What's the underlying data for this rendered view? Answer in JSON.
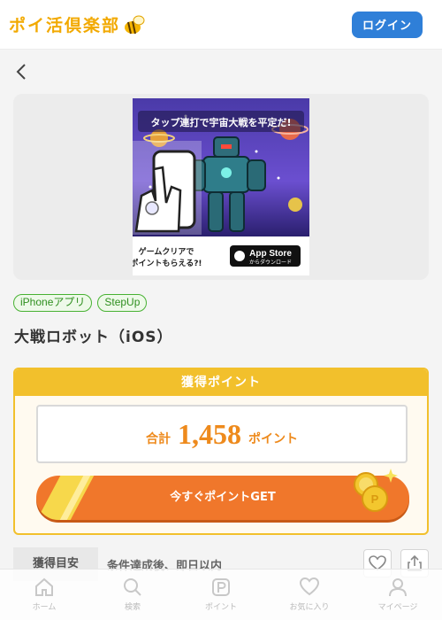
{
  "header": {
    "logo_text": "ポイ活倶楽部",
    "login_label": "ログイン"
  },
  "nav": {
    "back_icon": "chevron-left-icon"
  },
  "banner": {
    "headline": "タップ連打で宇宙大戦を平定だ!",
    "footer_text_line1": "ゲームクリアで",
    "footer_text_line2": "ポイントもらえる?!",
    "store_badge_line1": "App Store",
    "store_badge_line2": "からダウンロード"
  },
  "tags": [
    "iPhoneアプリ",
    "StepUp"
  ],
  "title": "大戦ロボット（iOS）",
  "points": {
    "header": "獲得ポイント",
    "total_label": "合計",
    "total_value": "1,458",
    "total_unit": "ポイント",
    "get_button_label": "今すぐポイントGET"
  },
  "guide": {
    "label": "獲得目安",
    "value": "条件達成後、即日以内"
  },
  "actions": {
    "favorite_icon": "heart-icon",
    "share_icon": "share-icon"
  },
  "tabbar": {
    "items": [
      {
        "label": "ホーム",
        "icon": "home-icon"
      },
      {
        "label": "検索",
        "icon": "search-icon"
      },
      {
        "label": "ポイント",
        "icon": "point-icon"
      },
      {
        "label": "お気に入り",
        "icon": "heart-icon"
      },
      {
        "label": "マイページ",
        "icon": "user-icon"
      }
    ]
  },
  "colors": {
    "accent_blue": "#2f7fd8",
    "accent_yellow": "#f2c02c",
    "accent_orange": "#f0772b",
    "tag_green": "#48b233"
  }
}
